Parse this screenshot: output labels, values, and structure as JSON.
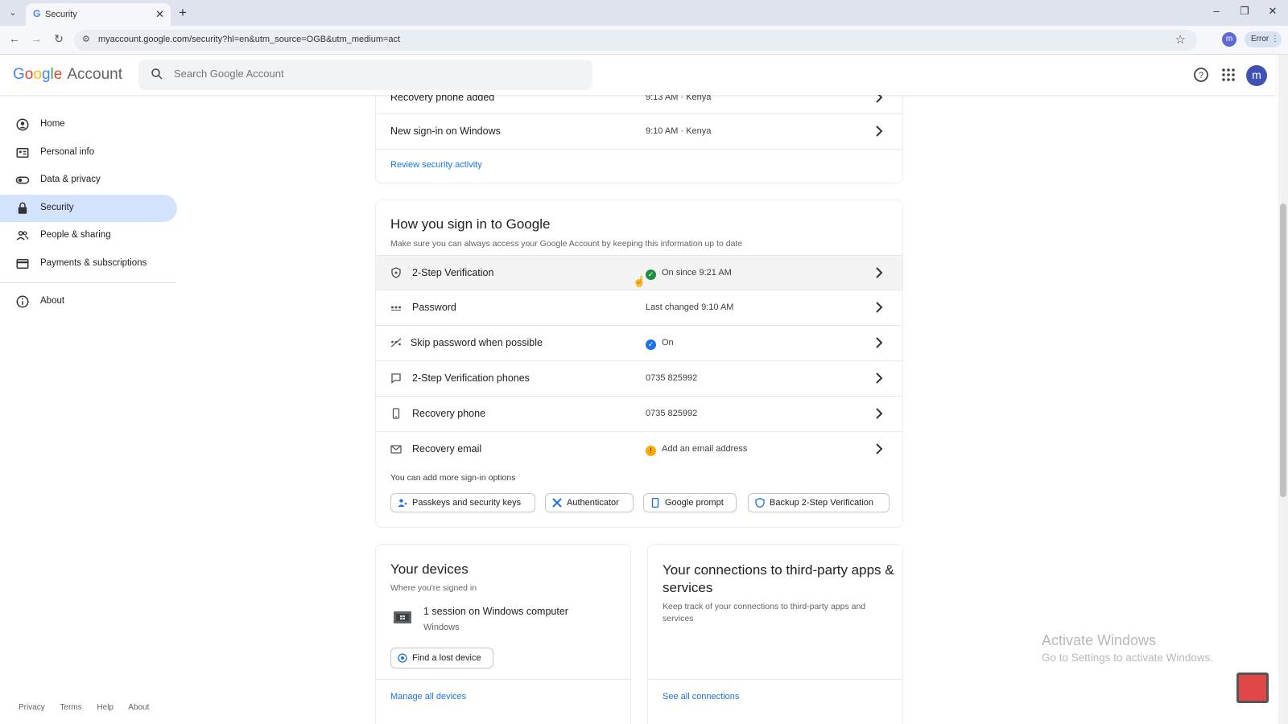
{
  "browser": {
    "tab_title": "Security",
    "url": "myaccount.google.com/security?hl=en&utm_source=OGB&utm_medium=act",
    "profile_letter": "m",
    "error_label": "Error"
  },
  "header": {
    "logo_g": "G",
    "logo_o1": "o",
    "logo_o2": "o",
    "logo_g2": "g",
    "logo_l": "l",
    "logo_e": "e",
    "logo_account": "Account",
    "search_placeholder": "Search Google Account",
    "avatar_letter": "m"
  },
  "sidebar": {
    "items": [
      {
        "label": "Home",
        "icon": "home-icon"
      },
      {
        "label": "Personal info",
        "icon": "id-card-icon"
      },
      {
        "label": "Data & privacy",
        "icon": "toggle-icon"
      },
      {
        "label": "Security",
        "icon": "lock-icon",
        "active": true
      },
      {
        "label": "People & sharing",
        "icon": "people-icon"
      },
      {
        "label": "Payments & subscriptions",
        "icon": "credit-card-icon"
      }
    ],
    "about": "About"
  },
  "footer": {
    "privacy": "Privacy",
    "terms": "Terms",
    "help": "Help",
    "about": "About"
  },
  "activity": {
    "rows": [
      {
        "title": "Recovery phone added",
        "value": "9:13 AM · Kenya"
      },
      {
        "title": "New sign-in on Windows",
        "value": "9:10 AM · Kenya"
      }
    ],
    "review_link": "Review security activity"
  },
  "signin": {
    "title": "How you sign in to Google",
    "subtitle": "Make sure you can always access your Google Account by keeping this information up to date",
    "rows": [
      {
        "title": "2-Step Verification",
        "value": "On since 9:21 AM",
        "status": "green"
      },
      {
        "title": "Password",
        "value": "Last changed 9:10 AM"
      },
      {
        "title": "Skip password when possible",
        "value": "On",
        "status": "blue"
      },
      {
        "title": "2-Step Verification phones",
        "value": "0735 825992"
      },
      {
        "title": "Recovery phone",
        "value": "0735 825992"
      },
      {
        "title": "Recovery email",
        "value": "Add an email address",
        "status": "warning"
      }
    ],
    "more_options": "You can add more sign-in options",
    "chips": [
      "Passkeys and security keys",
      "Authenticator",
      "Google prompt",
      "Backup 2-Step Verification"
    ]
  },
  "devices": {
    "title": "Your devices",
    "subtitle": "Where you're signed in",
    "session": "1 session on Windows computer",
    "os": "Windows",
    "find_button": "Find a lost device",
    "manage_link": "Manage all devices"
  },
  "connections": {
    "title": "Your connections to third-party apps & services",
    "subtitle": "Keep track of your connections to third-party apps and services",
    "see_all": "See all connections"
  },
  "watermark": {
    "line1": "Activate Windows",
    "line2": "Go to Settings to activate Windows."
  },
  "colors": {
    "accent": "#1a73e8",
    "active_nav": "#d3e3fd",
    "ok_green": "#1e8e3e",
    "warn": "#f9ab00"
  }
}
